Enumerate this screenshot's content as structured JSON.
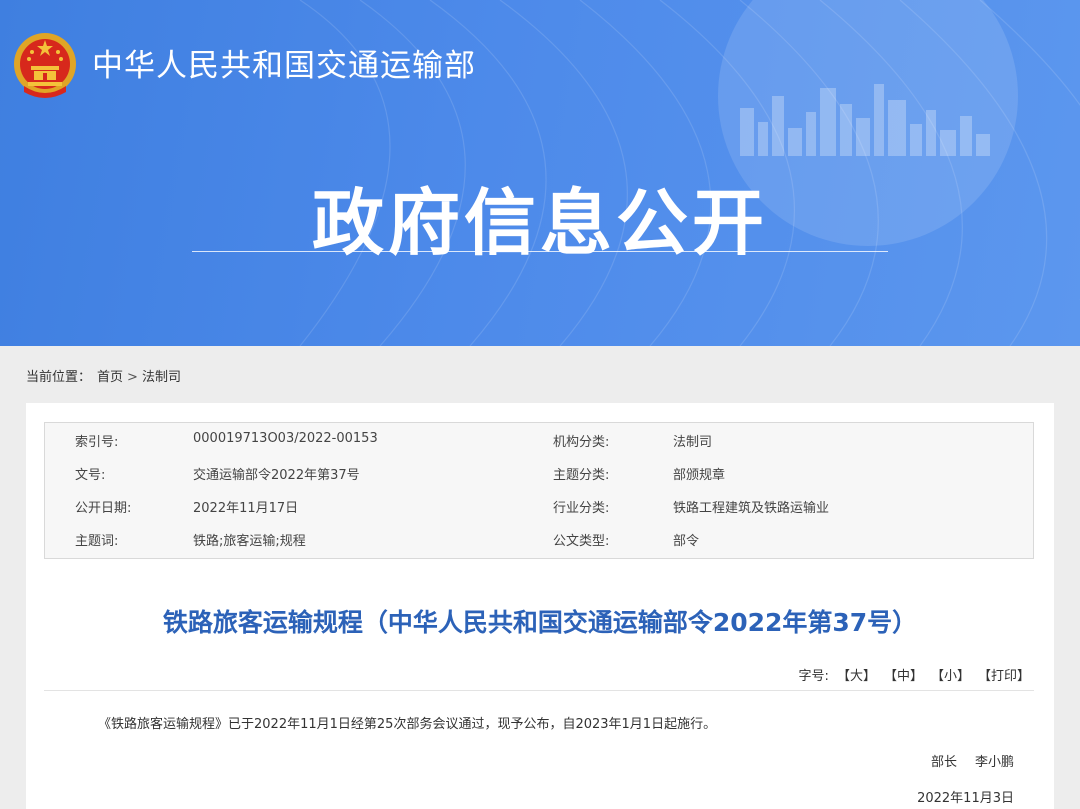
{
  "header": {
    "ministry_name": "中华人民共和国交通运输部",
    "banner_title": "政府信息公开",
    "colors": {
      "banner": "#4a86e8",
      "title": "#2c62b8"
    }
  },
  "breadcrumb": {
    "prefix": "当前位置：",
    "items": [
      "首页",
      "法制司"
    ],
    "separator": ">"
  },
  "metadata": {
    "rows": [
      {
        "label1": "索引号:",
        "value1": "000019713O03/2022-00153",
        "label2": "机构分类:",
        "value2": "法制司"
      },
      {
        "label1": "文号:",
        "value1": "交通运输部令2022年第37号",
        "label2": "主题分类:",
        "value2": "部颁规章"
      },
      {
        "label1": "公开日期:",
        "value1": "2022年11月17日",
        "label2": "行业分类:",
        "value2": "铁路工程建筑及铁路运输业"
      },
      {
        "label1": "主题词:",
        "value1": "铁路;旅客运输;规程",
        "label2": "公文类型:",
        "value2": "部令"
      }
    ]
  },
  "document": {
    "title": "铁路旅客运输规程（中华人民共和国交通运输部令2022年第37号）",
    "font_size_label": "字号:",
    "font_large": "【大】",
    "font_medium": "【中】",
    "font_small": "【小】",
    "print": "【打印】",
    "body": "《铁路旅客运输规程》已于2022年11月1日经第25次部务会议通过，现予公布，自2023年1月1日起施行。",
    "signer_title": "部长",
    "signer_name": "李小鹏",
    "sign_date": "2022年11月3日"
  }
}
